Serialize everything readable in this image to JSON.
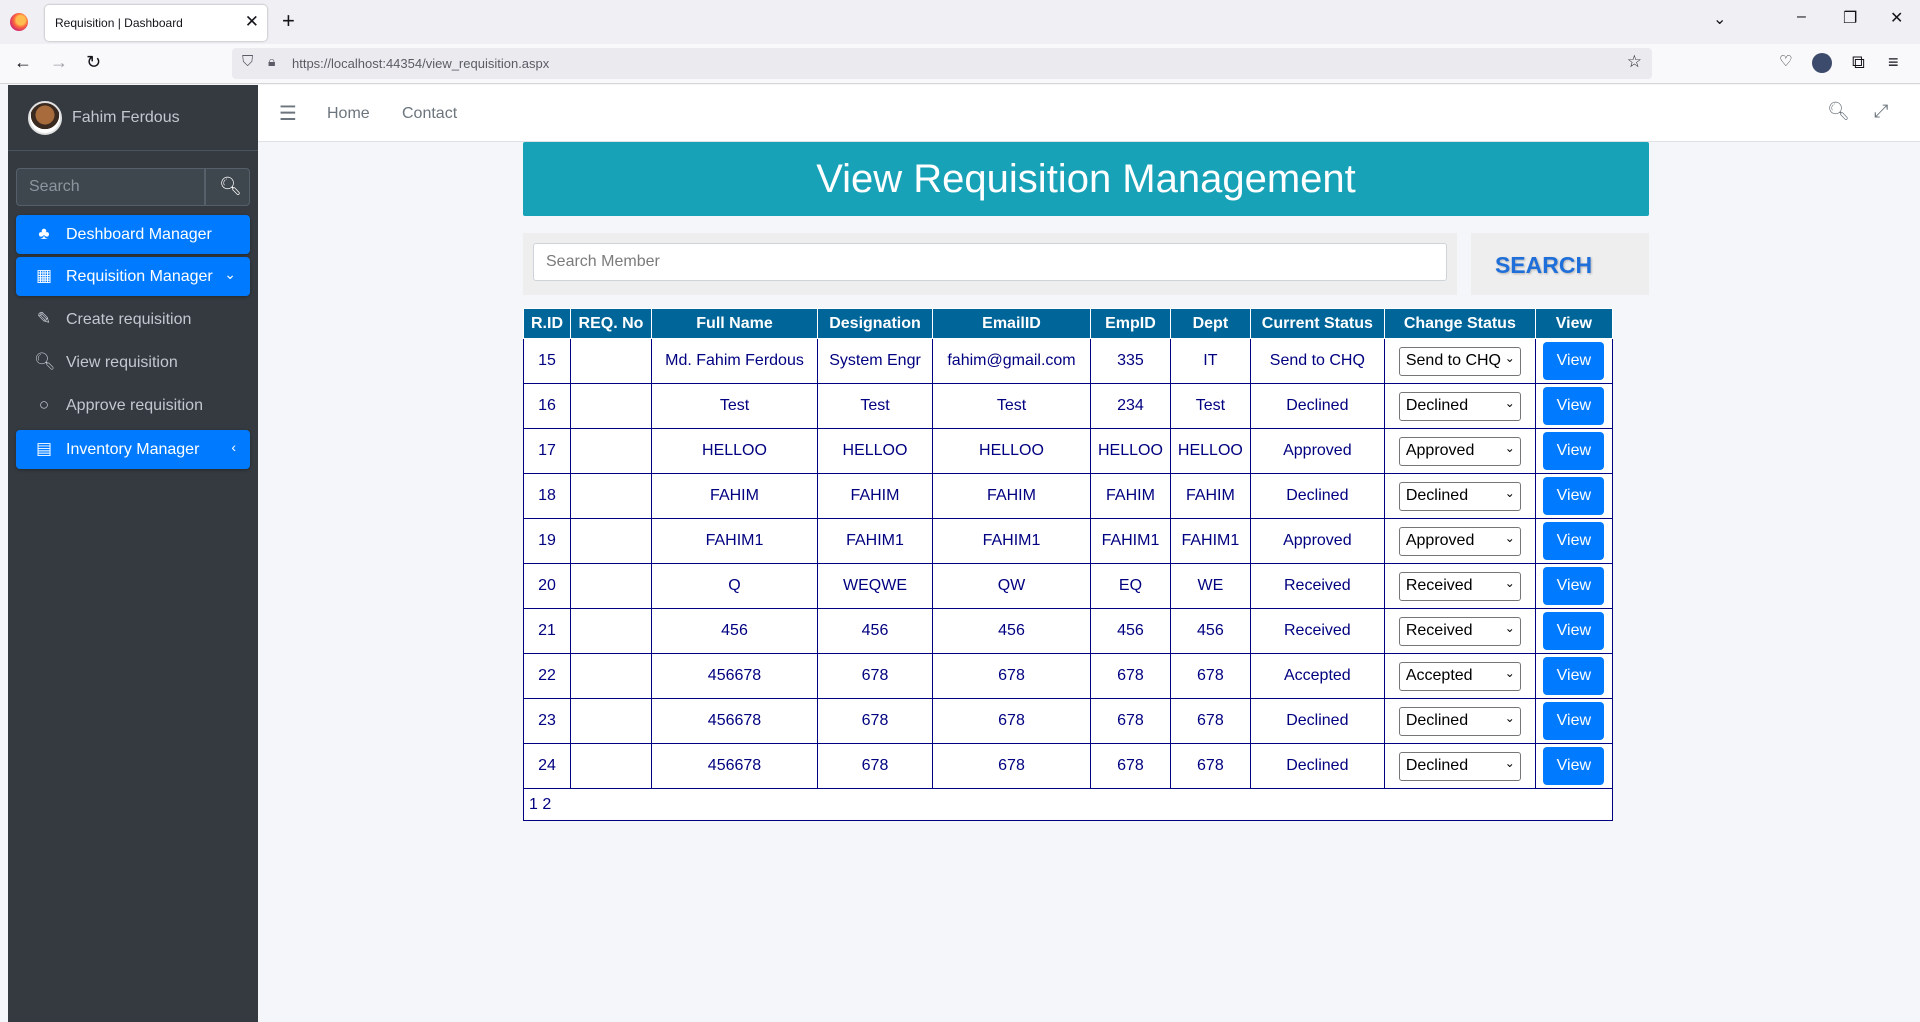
{
  "browser": {
    "tab_title": "Requisition | Dashboard",
    "url": "https://localhost:44354/view_requisition.aspx"
  },
  "sidebar": {
    "user_name": "Fahim Ferdous",
    "search_placeholder": "Search",
    "items": [
      {
        "label": "Deshboard Manager",
        "icon": "tree-icon",
        "active": true
      },
      {
        "label": "Requisition Manager",
        "icon": "grid-icon",
        "active": true
      },
      {
        "label": "Create requisition",
        "icon": "edit-icon",
        "active": false
      },
      {
        "label": "View requisition",
        "icon": "search-icon",
        "active": false
      },
      {
        "label": "Approve requisition",
        "icon": "circle-icon",
        "active": false
      },
      {
        "label": "Inventory Manager",
        "icon": "table-icon",
        "active": true
      }
    ]
  },
  "topnav": {
    "home": "Home",
    "contact": "Contact"
  },
  "page": {
    "title": "View Requisition Management",
    "search_placeholder": "Search Member",
    "search_button": "SEARCH"
  },
  "table": {
    "headers": [
      "R.ID",
      "REQ. No",
      "Full Name",
      "Designation",
      "EmailID",
      "EmpID",
      "Dept",
      "Current Status",
      "Change Status",
      "View"
    ],
    "rows": [
      {
        "rid": "15",
        "req": "",
        "name": "Md. Fahim Ferdous",
        "designation": "System Engr",
        "email": "fahim@gmail.com",
        "empid": "335",
        "dept": "IT",
        "status": "Send to CHQ",
        "change": "Send to CHQ",
        "view": "View"
      },
      {
        "rid": "16",
        "req": "",
        "name": "Test",
        "designation": "Test",
        "email": "Test",
        "empid": "234",
        "dept": "Test",
        "status": "Declined",
        "change": "Declined",
        "view": "View"
      },
      {
        "rid": "17",
        "req": "",
        "name": "HELLOO",
        "designation": "HELLOO",
        "email": "HELLOO",
        "empid": "HELLOO",
        "dept": "HELLOO",
        "status": "Approved",
        "change": "Approved",
        "view": "View"
      },
      {
        "rid": "18",
        "req": "",
        "name": "FAHIM",
        "designation": "FAHIM",
        "email": "FAHIM",
        "empid": "FAHIM",
        "dept": "FAHIM",
        "status": "Declined",
        "change": "Declined",
        "view": "View"
      },
      {
        "rid": "19",
        "req": "",
        "name": "FAHIM1",
        "designation": "FAHIM1",
        "email": "FAHIM1",
        "empid": "FAHIM1",
        "dept": "FAHIM1",
        "status": "Approved",
        "change": "Approved",
        "view": "View"
      },
      {
        "rid": "20",
        "req": "",
        "name": "Q",
        "designation": "WEQWE",
        "email": "QW",
        "empid": "EQ",
        "dept": "WE",
        "status": "Received",
        "change": "Received",
        "view": "View"
      },
      {
        "rid": "21",
        "req": "",
        "name": "456",
        "designation": "456",
        "email": "456",
        "empid": "456",
        "dept": "456",
        "status": "Received",
        "change": "Received",
        "view": "View"
      },
      {
        "rid": "22",
        "req": "",
        "name": "456678",
        "designation": "678",
        "email": "678",
        "empid": "678",
        "dept": "678",
        "status": "Accepted",
        "change": "Accepted",
        "view": "View"
      },
      {
        "rid": "23",
        "req": "",
        "name": "456678",
        "designation": "678",
        "email": "678",
        "empid": "678",
        "dept": "678",
        "status": "Declined",
        "change": "Declined",
        "view": "View"
      },
      {
        "rid": "24",
        "req": "",
        "name": "456678",
        "designation": "678",
        "email": "678",
        "empid": "678",
        "dept": "678",
        "status": "Declined",
        "change": "Declined",
        "view": "View"
      }
    ],
    "pager": "1 2"
  },
  "colors": {
    "header_teal": "#17a2b8",
    "table_header": "#006699",
    "primary": "#007bff",
    "sidebar_bg": "#343a40"
  }
}
